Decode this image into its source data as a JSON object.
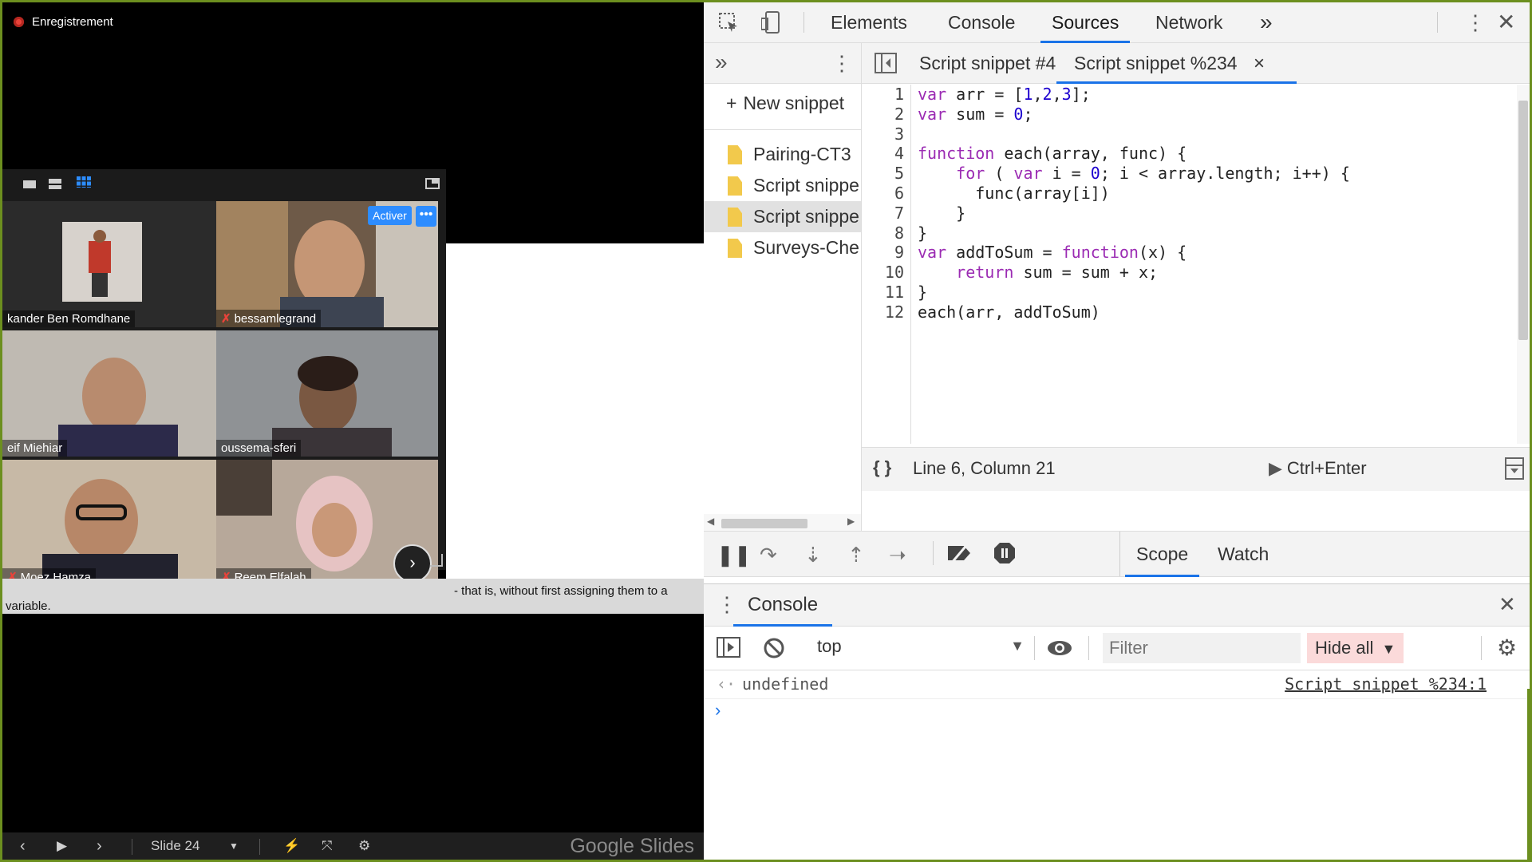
{
  "zoom": {
    "recording_label": "Enregistrement",
    "activer_label": "Activer",
    "more_label": "•••",
    "participants": [
      {
        "name": "kander Ben Romdhane",
        "muted": false
      },
      {
        "name": "bessamlegrand",
        "muted": true
      },
      {
        "name": "eif Miehiar",
        "muted": false
      },
      {
        "name": "oussema-sferi",
        "muted": false
      },
      {
        "name": "Moez Hamza",
        "muted": true
      },
      {
        "name": "Reem Elfalah",
        "muted": true
      }
    ],
    "mute_glyph": "✗",
    "next_glyph": "›"
  },
  "slide": {
    "caption_line1": "- that is, without first assigning them to a",
    "caption_line2": "variable.",
    "slide_label": "Slide 24",
    "brand": "Google Slides"
  },
  "devtools": {
    "tabs": [
      "Elements",
      "Console",
      "Sources",
      "Network"
    ],
    "active_tab": "Sources",
    "overflow": "»",
    "navigator": {
      "new_snippet": "New snippet",
      "files": [
        "Pairing-CT3",
        "Script snippe",
        "Script snippe",
        "Surveys-Che"
      ],
      "selected_index": 2
    },
    "editor": {
      "tabs": [
        "Script snippet #4",
        "Script snippet %234"
      ],
      "active_tab": "Script snippet %234",
      "close_glyph": "×",
      "lines": [
        "var arr = [1,2,3];",
        "var sum = 0;",
        "",
        "function each(array, func) {",
        "    for ( var i = 0; i < array.length; i++) {",
        "      func(array[i])",
        "    }",
        "}",
        "var addToSum = function(x) {",
        "    return sum = sum + x;",
        "}",
        "each(arr, addToSum)"
      ],
      "line_numbers": [
        "1",
        "2",
        "3",
        "4",
        "5",
        "6",
        "7",
        "8",
        "9",
        "10",
        "11",
        "12"
      ],
      "status": "Line 6, Column 21",
      "run_hint": "Ctrl+Enter",
      "format_glyph": "{ }"
    },
    "sidebar_tabs": [
      "Scope",
      "Watch"
    ],
    "active_sidebar_tab": "Scope",
    "console": {
      "title": "Console",
      "context": "top",
      "filter_placeholder": "Filter",
      "levels": "Hide all",
      "output": "undefined",
      "source_link": "Script snippet %234:1",
      "prompt": "›"
    }
  },
  "colors": {
    "accent": "#1a73e8",
    "keyword": "#9b2bb3",
    "number": "#1c00cf",
    "mute": "#e8433a",
    "zoom_button": "#2d8cff"
  }
}
